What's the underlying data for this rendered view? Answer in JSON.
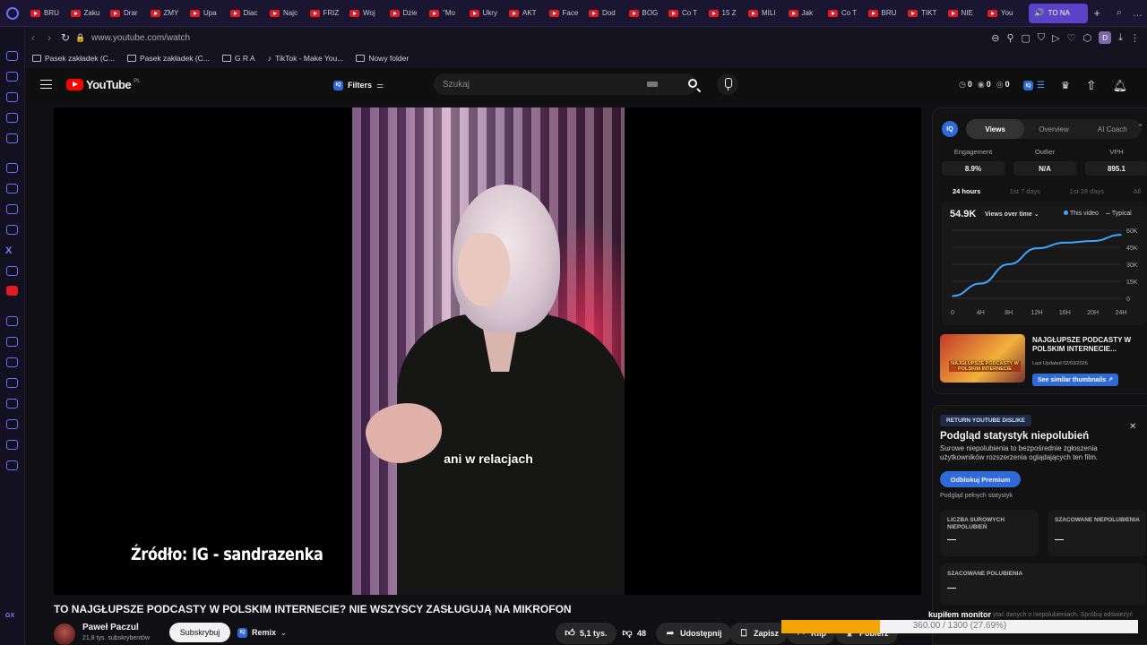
{
  "browser": {
    "tabs": [
      {
        "label": "BRU"
      },
      {
        "label": "Zaku"
      },
      {
        "label": "Drar"
      },
      {
        "label": "ZMY"
      },
      {
        "label": "Upa"
      },
      {
        "label": "Diac"
      },
      {
        "label": "Najc"
      },
      {
        "label": "FRIZ"
      },
      {
        "label": "Woj"
      },
      {
        "label": "Dzie"
      },
      {
        "label": "\"Mo"
      },
      {
        "label": "Ukry"
      },
      {
        "label": "AKT"
      },
      {
        "label": "Face"
      },
      {
        "label": "Dod"
      },
      {
        "label": "BOG"
      },
      {
        "label": "Co T"
      },
      {
        "label": "15 Z"
      },
      {
        "label": "MILI"
      },
      {
        "label": "Jak"
      },
      {
        "label": "Co T"
      },
      {
        "label": "BRU"
      },
      {
        "label": "TIKT"
      },
      {
        "label": "NIE"
      },
      {
        "label": "You"
      }
    ],
    "active_tab": "TO NA",
    "url": "www.youtube.com/watch",
    "avatar_letter": "D",
    "bookmarks": [
      {
        "label": "Pasek zakładek (C...",
        "icon": "folder"
      },
      {
        "label": "Pasek zakładek (C...",
        "icon": "folder"
      },
      {
        "label": "G R A",
        "icon": "folder"
      },
      {
        "label": "TikTok - Make You...",
        "icon": "tiktok"
      },
      {
        "label": "Nowy folder",
        "icon": "folder"
      }
    ]
  },
  "youtube": {
    "logo_text": "YouTube",
    "region": "PL",
    "filters_label": "Filters",
    "search_placeholder": "Szukaj",
    "header_counts": [
      "0",
      "0",
      "0"
    ],
    "video": {
      "subtitle": "ani w relacjach",
      "source_overlay": "Źródło: IG - sandrazenka",
      "title": "TO NAJGŁUPSZE PODCASTY W POLSKIM INTERNECIE? NIE WSZYSCY ZASŁUGUJĄ NA MIKROFON"
    },
    "channel": {
      "name": "Paweł Paczul",
      "subscribers": "21,8 tys. subskrybentów",
      "subscribe_label": "Subskrybuj"
    },
    "actions": {
      "remix": "Remix",
      "likes": "5,1 tys.",
      "dislikes": "48",
      "share": "Udostępnij",
      "save": "Zapisz",
      "clip": "Klip",
      "download": "Pobierz"
    }
  },
  "vidiq": {
    "logo": "IQ",
    "tabs": [
      "Views",
      "Overview",
      "AI Coach"
    ],
    "active_tab": "Views",
    "metrics": [
      {
        "label": "Engagement",
        "value": "8.9%"
      },
      {
        "label": "Outlier",
        "value": "N/A"
      },
      {
        "label": "VPH",
        "value": "895.1"
      }
    ],
    "periods": [
      "24 hours",
      "1st 7 days",
      "1st 28 days",
      "All"
    ],
    "active_period": "24 hours",
    "views_total": "54.9K",
    "views_selector": "Views over time",
    "legend_this": "This video",
    "legend_typical": "Typical",
    "thumbnail_text": "NAJGŁUPSZE PODCASTY W POLSKIM INTERNECIE",
    "video_title": "NAJGŁUPSZE PODCASTY W POLSKIM INTERNECIE...",
    "last_updated": "Last Updated 02/03/2026",
    "similar_button": "See similar thumbnails"
  },
  "chart_data": {
    "type": "line",
    "x": [
      "0",
      "4H",
      "8H",
      "12H",
      "16H",
      "20H",
      "24H"
    ],
    "series": [
      {
        "name": "This video",
        "values": [
          2000,
          13000,
          30000,
          44000,
          49000,
          50500,
          56000
        ]
      }
    ],
    "yticks": [
      "60K",
      "45K",
      "30K",
      "15K",
      "0"
    ],
    "ylim": [
      0,
      60000
    ],
    "color": "#3ea6ff"
  },
  "ryd": {
    "badge": "RETURN YOUTUBE DISLIKE",
    "title": "Podgląd statystyk niepolubień",
    "description": "Surowe niepolubienia to bezpośrednie zgłoszenia użytkowników rozszerzenia oglądających ten film.",
    "unlock_button": "Odblokuj Premium",
    "subtext": "Podgląd pełnych statystyk",
    "stats": [
      {
        "label": "LICZBA SUROWYCH NIEPOLUBIEŃ",
        "value": "—"
      },
      {
        "label": "SZACOWANE NIEPOLUBIENIA",
        "value": "—"
      },
      {
        "label": "SZACOWANE POLUBIENIA",
        "value": "—"
      }
    ],
    "footer": "ytać danych o niepolubieniach. Spróbuj odświeżyć"
  },
  "overlay": {
    "label": "kupiłem monitor",
    "progress_text": "360.00 / 1300 (27.69%)",
    "progress_fraction": 0.2769,
    "fill_color": "#f2a400"
  }
}
